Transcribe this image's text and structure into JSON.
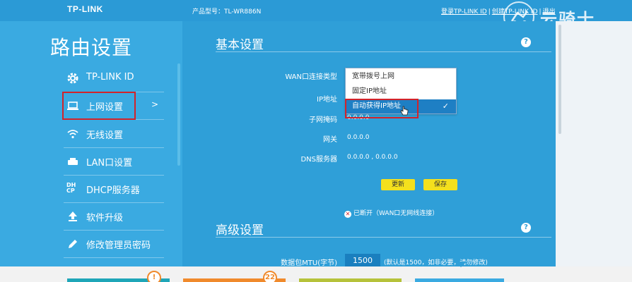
{
  "header": {
    "logo": "TP-LINK",
    "model_label": "产品型号：TL-WR886N",
    "links": [
      "登录TP-LINK ID",
      "创建TP-LINK ID",
      "退出"
    ],
    "separator": "|"
  },
  "watermark": {
    "text": "云骑士"
  },
  "sidebar": {
    "title": "路由设置",
    "items": [
      {
        "label": "TP-LINK ID",
        "icon": "gear-icon"
      },
      {
        "label": "上网设置",
        "icon": "laptop-icon",
        "chevron": ">"
      },
      {
        "label": "无线设置",
        "icon": "wifi-icon"
      },
      {
        "label": "LAN口设置",
        "icon": "lan-icon"
      },
      {
        "label": "DHCP服务器",
        "icon": "dhcp-icon",
        "icon_text": "DH CP"
      },
      {
        "label": "软件升级",
        "icon": "upload-icon"
      },
      {
        "label": "修改管理员密码",
        "icon": "pencil-icon"
      }
    ]
  },
  "basic": {
    "title": "基本设置",
    "help": "?",
    "fields": [
      {
        "label": "WAN口连接类型",
        "value": ""
      },
      {
        "label": "IP地址",
        "value": ""
      },
      {
        "label": "子网掩码",
        "value": "0.0.0.0"
      },
      {
        "label": "网关",
        "value": "0.0.0.0"
      },
      {
        "label": "DNS服务器",
        "value": "0.0.0.0 , 0.0.0.0"
      }
    ],
    "refresh_label": "更新",
    "save_label": "保存",
    "status_icon": "✕",
    "status": "已断开（WAN口无网线连接）"
  },
  "dropdown": {
    "options": [
      "宽带拨号上网",
      "固定IP地址",
      "自动获得IP地址"
    ],
    "selected_index": 2,
    "check": "✓"
  },
  "advanced": {
    "title": "高级设置",
    "help": "?",
    "mtu_label": "数据包MTU(字节)",
    "mtu_value": "1500",
    "mtu_hint": "(默认是1500，如非必要，请勿修改)"
  },
  "bottom": {
    "badges": [
      "!",
      "22"
    ],
    "colors": {
      "teal": "#1fa6b8",
      "orange": "#f08a2c",
      "olive": "#b6c23a",
      "blue": "#3aaae1"
    }
  },
  "colors": {
    "accent": "#2f9fd8",
    "highlight": "#d2232a",
    "button": "#f4e01d"
  }
}
